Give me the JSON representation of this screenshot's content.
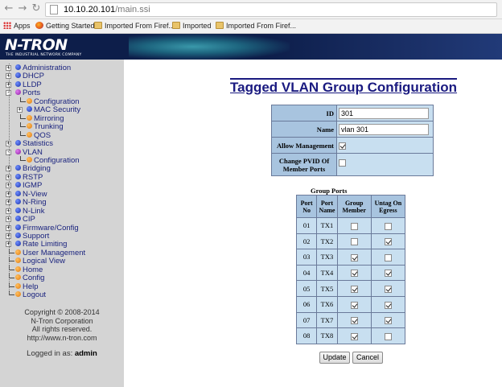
{
  "browser": {
    "url_host": "10.10.20.101",
    "url_path": "/main.ssi",
    "bookmarks": [
      "Apps",
      "Getting Started",
      "Imported From Firef...",
      "Imported",
      "Imported From Firef..."
    ]
  },
  "header": {
    "logo": "N-TRON",
    "logo_sub": "THE INDUSTRIAL NETWORK COMPANY"
  },
  "sidebar": {
    "items": [
      {
        "label": "Administration",
        "level": 0,
        "icon": "blue-dot",
        "expander": "+"
      },
      {
        "label": "DHCP",
        "level": 0,
        "icon": "blue-dot",
        "expander": "+"
      },
      {
        "label": "LLDP",
        "level": 0,
        "icon": "blue-dot",
        "expander": "+"
      },
      {
        "label": "Ports",
        "level": 0,
        "icon": "purple-dot",
        "expander": "-"
      },
      {
        "label": "Configuration",
        "level": 1,
        "icon": "orange-dot"
      },
      {
        "label": "MAC Security",
        "level": 1,
        "icon": "blue-dot",
        "expander": "+"
      },
      {
        "label": "Mirroring",
        "level": 1,
        "icon": "orange-dot"
      },
      {
        "label": "Trunking",
        "level": 1,
        "icon": "orange-dot"
      },
      {
        "label": "QOS",
        "level": 1,
        "icon": "orange-dot"
      },
      {
        "label": "Statistics",
        "level": 0,
        "icon": "blue-dot",
        "expander": "+"
      },
      {
        "label": "VLAN",
        "level": 0,
        "icon": "purple-dot",
        "expander": "-"
      },
      {
        "label": "Configuration",
        "level": 1,
        "icon": "orange-dot"
      },
      {
        "label": "Bridging",
        "level": 0,
        "icon": "blue-dot",
        "expander": "+"
      },
      {
        "label": "RSTP",
        "level": 0,
        "icon": "blue-dot",
        "expander": "+"
      },
      {
        "label": "IGMP",
        "level": 0,
        "icon": "blue-dot",
        "expander": "+"
      },
      {
        "label": "N-View",
        "level": 0,
        "icon": "blue-dot",
        "expander": "+"
      },
      {
        "label": "N-Ring",
        "level": 0,
        "icon": "blue-dot",
        "expander": "+"
      },
      {
        "label": "N-Link",
        "level": 0,
        "icon": "blue-dot",
        "expander": "+"
      },
      {
        "label": "CIP",
        "level": 0,
        "icon": "blue-dot",
        "expander": "+"
      },
      {
        "label": "Firmware/Config",
        "level": 0,
        "icon": "blue-dot",
        "expander": "+"
      },
      {
        "label": "Support",
        "level": 0,
        "icon": "blue-dot",
        "expander": "+"
      },
      {
        "label": "Rate Limiting",
        "level": 0,
        "icon": "blue-dot",
        "expander": "+"
      },
      {
        "label": "User Management",
        "level": 0,
        "icon": "orange-dot"
      },
      {
        "label": "Logical View",
        "level": 0,
        "icon": "orange-dot"
      },
      {
        "label": "Home",
        "level": 0,
        "icon": "orange-dot"
      },
      {
        "label": "Config",
        "level": 0,
        "icon": "orange-dot"
      },
      {
        "label": "Help",
        "level": 0,
        "icon": "orange-dot"
      },
      {
        "label": "Logout",
        "level": 0,
        "icon": "orange-dot"
      }
    ],
    "copyright": [
      "Copyright © 2008-2014",
      "N-Tron Corporation",
      "All rights reserved.",
      "http://www.n-tron.com"
    ],
    "logged_prefix": "Logged in as:",
    "logged_user": "admin"
  },
  "main": {
    "title": "Tagged VLAN Group Configuration",
    "form": {
      "id_label": "ID",
      "id_value": "301",
      "name_label": "Name",
      "name_value": "vlan 301",
      "allow_mgmt_label": "Allow Management",
      "allow_mgmt_checked": true,
      "change_pvid_label": "Change PVID Of Member Ports",
      "change_pvid_checked": false
    },
    "group_ports": {
      "title": "Group Ports",
      "headers": [
        "Port No",
        "Port Name",
        "Group Member",
        "Untag On Egress"
      ],
      "rows": [
        {
          "no": "01",
          "name": "TX1",
          "member": false,
          "untag": false
        },
        {
          "no": "02",
          "name": "TX2",
          "member": false,
          "untag": true
        },
        {
          "no": "03",
          "name": "TX3",
          "member": true,
          "untag": false
        },
        {
          "no": "04",
          "name": "TX4",
          "member": true,
          "untag": true
        },
        {
          "no": "05",
          "name": "TX5",
          "member": true,
          "untag": true
        },
        {
          "no": "06",
          "name": "TX6",
          "member": true,
          "untag": true
        },
        {
          "no": "07",
          "name": "TX7",
          "member": true,
          "untag": true
        },
        {
          "no": "08",
          "name": "TX8",
          "member": true,
          "untag": false
        }
      ]
    },
    "buttons": {
      "update": "Update",
      "cancel": "Cancel"
    }
  }
}
